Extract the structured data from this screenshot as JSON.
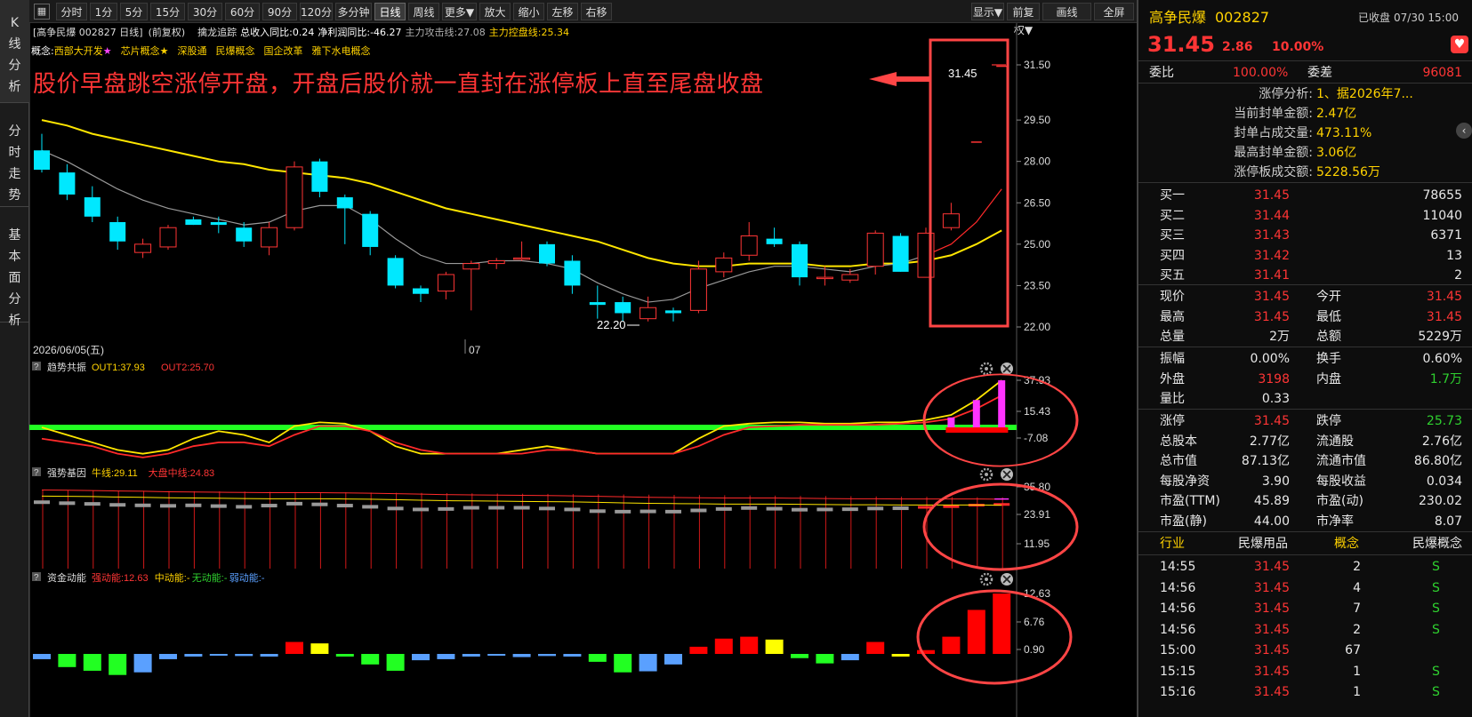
{
  "sidebar": {
    "tabs": [
      {
        "label": "K线分析"
      },
      {
        "label": "分时走势"
      },
      {
        "label": "基本面分析"
      }
    ]
  },
  "toolbar": {
    "left": [
      "分时",
      "1分",
      "5分",
      "15分",
      "30分",
      "60分",
      "90分",
      "120分",
      "多分钟",
      "日线",
      "周线",
      "更多▼",
      "放大",
      "缩小",
      "左移",
      "右移"
    ],
    "active": "日线",
    "right": [
      "显示▼",
      "前复权▼",
      "画线",
      "全屏"
    ]
  },
  "chart": {
    "header": {
      "name": "[高争民爆 002827 日线]",
      "adj": "(前复权)",
      "indicator": "擒龙追踪",
      "items": [
        {
          "label": "总收入同比:0.24",
          "color": "#ffffff"
        },
        {
          "label": "净利润同比:-46.27",
          "color": "#ffffff"
        },
        {
          "label": "主力攻击线:27.08",
          "color": "#b0b0b0"
        },
        {
          "label": "主力控盘线:25.34",
          "color": "#ffd200"
        }
      ]
    },
    "concepts": {
      "prefix": "概念:",
      "items": [
        {
          "label": "西部大开发",
          "star": "★",
          "star_color": "#ff44ff"
        },
        {
          "label": "芯片概念",
          "star": "★",
          "star_color": "#ffd200"
        },
        {
          "label": "深股通",
          "star": ""
        },
        {
          "label": "民爆概念",
          "star": ""
        },
        {
          "label": "国企改革",
          "star": ""
        },
        {
          "label": "雅下水电概念",
          "star": ""
        }
      ]
    },
    "annotation": "股价早盘跳空涨停开盘，开盘后股价就一直封在涨停板上直至尾盘收盘",
    "price_axis": [
      "31.50",
      "29.50",
      "28.00",
      "26.50",
      "25.00",
      "23.50",
      "22.00"
    ],
    "last_price_label": "31.45",
    "low_label": "22.20",
    "date_labels": [
      "2026/06/05(五)",
      "07"
    ],
    "candles": [
      [
        28.4,
        29.0,
        27.6,
        27.7
      ],
      [
        27.6,
        27.9,
        26.6,
        26.8
      ],
      [
        26.7,
        27.1,
        25.8,
        26.0
      ],
      [
        25.8,
        26.0,
        24.8,
        25.1
      ],
      [
        24.7,
        25.2,
        24.5,
        25.0
      ],
      [
        24.9,
        25.7,
        24.8,
        25.6
      ],
      [
        25.9,
        26.0,
        25.7,
        25.7
      ],
      [
        25.8,
        26.0,
        25.4,
        25.7
      ],
      [
        25.6,
        25.8,
        24.9,
        25.1
      ],
      [
        24.9,
        25.8,
        24.6,
        25.6
      ],
      [
        25.6,
        28.0,
        25.5,
        27.8
      ],
      [
        28.0,
        28.1,
        26.7,
        26.9
      ],
      [
        26.7,
        26.8,
        25.0,
        26.3
      ],
      [
        26.1,
        26.2,
        24.6,
        24.9
      ],
      [
        24.5,
        24.6,
        23.4,
        23.5
      ],
      [
        23.4,
        23.5,
        22.9,
        23.2
      ],
      [
        23.3,
        24.0,
        23.0,
        23.9
      ],
      [
        24.1,
        24.4,
        22.6,
        24.3
      ],
      [
        24.3,
        24.5,
        24.1,
        24.4
      ],
      [
        24.5,
        25.1,
        24.4,
        24.5
      ],
      [
        25.0,
        25.1,
        24.2,
        24.3
      ],
      [
        24.4,
        24.6,
        23.2,
        23.5
      ],
      [
        22.9,
        23.5,
        22.3,
        22.8
      ],
      [
        22.9,
        23.1,
        22.2,
        22.5
      ],
      [
        22.3,
        23.1,
        22.2,
        22.7
      ],
      [
        22.6,
        22.7,
        22.2,
        22.5
      ],
      [
        22.6,
        24.4,
        22.5,
        24.1
      ],
      [
        24.0,
        24.7,
        23.8,
        24.5
      ],
      [
        24.6,
        25.8,
        24.4,
        25.3
      ],
      [
        25.2,
        25.6,
        24.9,
        25.0
      ],
      [
        25.0,
        25.1,
        23.5,
        23.8
      ],
      [
        23.8,
        24.2,
        23.5,
        23.8
      ],
      [
        23.7,
        24.1,
        23.6,
        23.9
      ],
      [
        24.2,
        25.5,
        23.9,
        25.4
      ],
      [
        25.3,
        25.4,
        24.0,
        24.0
      ],
      [
        23.8,
        25.6,
        23.8,
        25.4
      ],
      [
        25.6,
        26.5,
        25.5,
        26.1
      ],
      [
        28.7,
        28.7,
        28.7,
        28.7
      ],
      [
        31.45,
        31.45,
        31.45,
        31.45
      ]
    ],
    "ma_yellow": [
      29.5,
      29.3,
      29.0,
      28.8,
      28.6,
      28.4,
      28.2,
      28.0,
      27.9,
      27.7,
      27.6,
      27.5,
      27.4,
      27.2,
      26.9,
      26.6,
      26.3,
      26.1,
      25.9,
      25.7,
      25.5,
      25.3,
      25.1,
      24.8,
      24.5,
      24.3,
      24.2,
      24.2,
      24.3,
      24.3,
      24.3,
      24.2,
      24.2,
      24.3,
      24.3,
      24.4,
      24.6,
      25.0,
      25.5
    ],
    "ma_gray": [
      28.4,
      28.0,
      27.5,
      27.0,
      26.6,
      26.3,
      26.1,
      25.9,
      25.7,
      25.8,
      26.2,
      26.4,
      26.4,
      25.9,
      25.2,
      24.6,
      24.3,
      24.3,
      24.4,
      24.4,
      24.3,
      24.1,
      23.6,
      23.2,
      22.9,
      23.0,
      23.4,
      23.7,
      24.0,
      24.2,
      24.2,
      24.1,
      24.0,
      24.2,
      24.3,
      24.6,
      25.0,
      25.8,
      27.0
    ],
    "panels": [
      {
        "name": "趋势共振",
        "values": [
          {
            "label": "OUT1:37.93",
            "color": "#ffd200"
          },
          {
            "label": "OUT2:25.70",
            "color": "#ff3535"
          }
        ],
        "axis": [
          "37.93",
          "15.43",
          "-7.08"
        ]
      },
      {
        "name": "强势基因",
        "values": [
          {
            "label": "牛线:29.11",
            "color": "#ffd200"
          },
          {
            "label": "大盘中线:24.83",
            "color": "#ff3535"
          }
        ],
        "axis": [
          "35.80",
          "23.91",
          "11.95"
        ]
      },
      {
        "name": "资金动能",
        "values": [
          {
            "label": "强动能:12.63",
            "color": "#ff3535"
          },
          {
            "label": "中动能:-",
            "color": "#ffd200"
          },
          {
            "label": "无动能:-",
            "color": "#2fd02f"
          },
          {
            "label": "弱动能:-",
            "color": "#5aa0ff"
          }
        ],
        "axis": [
          "12.63",
          "6.76",
          "0.90"
        ]
      }
    ],
    "funds": [
      [
        -1,
        "b"
      ],
      [
        -2.5,
        "g"
      ],
      [
        -3.2,
        "g"
      ],
      [
        -4,
        "g"
      ],
      [
        -3.5,
        "b"
      ],
      [
        -1,
        "b"
      ],
      [
        -0.5,
        "b"
      ],
      [
        -0.3,
        "b"
      ],
      [
        -0.4,
        "b"
      ],
      [
        -0.5,
        "b"
      ],
      [
        2.5,
        "r"
      ],
      [
        2.2,
        "y"
      ],
      [
        -0.5,
        "g"
      ],
      [
        -2,
        "g"
      ],
      [
        -3.2,
        "g"
      ],
      [
        -1.2,
        "b"
      ],
      [
        -1,
        "b"
      ],
      [
        -0.5,
        "b"
      ],
      [
        -0.3,
        "b"
      ],
      [
        -0.6,
        "b"
      ],
      [
        -0.4,
        "b"
      ],
      [
        -0.5,
        "b"
      ],
      [
        -1.5,
        "g"
      ],
      [
        -3.5,
        "g"
      ],
      [
        -3.3,
        "b"
      ],
      [
        -2,
        "b"
      ],
      [
        1.5,
        "r"
      ],
      [
        3.2,
        "r"
      ],
      [
        3.6,
        "r"
      ],
      [
        3.0,
        "y"
      ],
      [
        -0.8,
        "g"
      ],
      [
        -1.8,
        "g"
      ],
      [
        -1.2,
        "b"
      ],
      [
        2.5,
        "r"
      ],
      [
        -0.5,
        "y"
      ],
      [
        0.8,
        "r"
      ],
      [
        3.6,
        "r"
      ],
      [
        9.2,
        "r"
      ],
      [
        12.63,
        "r"
      ]
    ]
  },
  "quote": {
    "name": "高争民爆",
    "code": "002827",
    "status": "已收盘",
    "time": "07/30 15:00",
    "price": "31.45",
    "change": "2.86",
    "pct": "10.00%",
    "wb_label": "委比",
    "wb": "100.00%",
    "wc_label": "委差",
    "wc": "96081",
    "limit_info": [
      {
        "k": "涨停分析:",
        "v": "1、据2026年7..."
      },
      {
        "k": "当前封单金额:",
        "v": "2.47亿"
      },
      {
        "k": "封单占成交量:",
        "v": "473.11%"
      },
      {
        "k": "最高封单金额:",
        "v": "3.06亿"
      },
      {
        "k": "涨停板成交额:",
        "v": "5228.56万"
      }
    ],
    "book": [
      {
        "k": "买一",
        "p": "31.45",
        "v": "78655"
      },
      {
        "k": "买二",
        "p": "31.44",
        "v": "11040"
      },
      {
        "k": "买三",
        "p": "31.43",
        "v": "6371"
      },
      {
        "k": "买四",
        "p": "31.42",
        "v": "13"
      },
      {
        "k": "买五",
        "p": "31.41",
        "v": "2"
      }
    ],
    "stats1": [
      [
        "现价",
        "31.45",
        "red",
        "今开",
        "31.45",
        "red"
      ],
      [
        "最高",
        "31.45",
        "red",
        "最低",
        "31.45",
        "red"
      ],
      [
        "总量",
        "2万",
        "wht",
        "总额",
        "5229万",
        "wht"
      ]
    ],
    "stats2": [
      [
        "振幅",
        "0.00%",
        "wht",
        "换手",
        "0.60%",
        "wht"
      ],
      [
        "外盘",
        "3198",
        "red",
        "内盘",
        "1.7万",
        "grn"
      ],
      [
        "量比",
        "0.33",
        "wht",
        "",
        "",
        " "
      ]
    ],
    "stats3": [
      [
        "涨停",
        "31.45",
        "red",
        "跌停",
        "25.73",
        "grn"
      ],
      [
        "总股本",
        "2.77亿",
        "wht",
        "流通股",
        "2.76亿",
        "wht"
      ],
      [
        "总市值",
        "87.13亿",
        "wht",
        "流通市值",
        "86.80亿",
        "wht"
      ],
      [
        "每股净资",
        "3.90",
        "wht",
        "每股收益",
        "0.034",
        "wht"
      ],
      [
        "市盈(TTM)",
        "45.89",
        "wht",
        "市盈(动)",
        "230.02",
        "wht"
      ],
      [
        "市盈(静)",
        "44.00",
        "wht",
        "市净率",
        "8.07",
        "wht"
      ]
    ],
    "industry": {
      "k1": "行业",
      "v1": "民爆用品",
      "k2": "概念",
      "v2": "民爆概念"
    },
    "ticks": [
      [
        "14:55",
        "31.45",
        "2",
        "S"
      ],
      [
        "14:56",
        "31.45",
        "4",
        "S"
      ],
      [
        "14:56",
        "31.45",
        "7",
        "S"
      ],
      [
        "14:56",
        "31.45",
        "2",
        "S"
      ],
      [
        "15:00",
        "31.45",
        "67",
        ""
      ],
      [
        "15:15",
        "31.45",
        "1",
        "S"
      ],
      [
        "15:16",
        "31.45",
        "1",
        "S"
      ]
    ]
  }
}
